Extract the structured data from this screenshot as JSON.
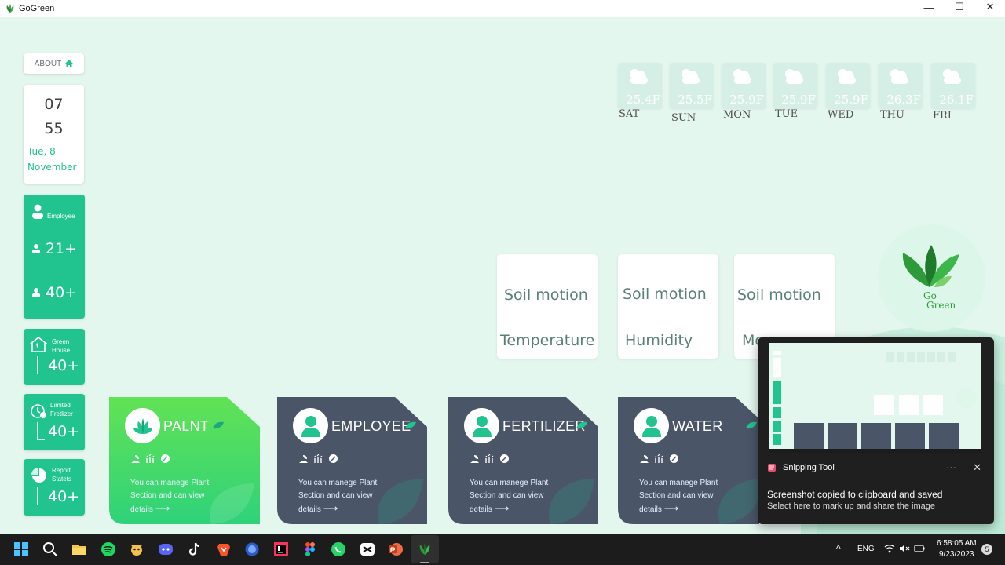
{
  "window": {
    "title": "GoGreen",
    "minimize": "—",
    "maximize": "☐",
    "close": "✕"
  },
  "sidebar": {
    "about_label": "ABOUT",
    "clock": {
      "hour": "07",
      "minute": "55",
      "date_line1": "Tue, 8",
      "date_line2": "November"
    },
    "employee": {
      "label": "Employee",
      "count1": "21+",
      "count2": "40+"
    },
    "greenhouse": {
      "label_line1": "Green",
      "label_line2": "House",
      "count": "40+"
    },
    "fertilizer": {
      "label_line1": "Limited",
      "label_line2": "Fretlizer",
      "count": "40+"
    },
    "report": {
      "label_line1": "Report",
      "label_line2": "Statets",
      "count": "40+"
    }
  },
  "weather": [
    {
      "temp": "25.4F",
      "day": "SAT"
    },
    {
      "temp": "25.5F",
      "day": "SUN"
    },
    {
      "temp": "25.9F",
      "day": "MON"
    },
    {
      "temp": "25.9F",
      "day": "TUE"
    },
    {
      "temp": "25.9F",
      "day": "WED"
    },
    {
      "temp": "26.3F",
      "day": "THU"
    },
    {
      "temp": "26.1F",
      "day": "FRI"
    }
  ],
  "soil_cards": [
    {
      "line1": "Soil motion",
      "line2": "Temperature"
    },
    {
      "line1": "Soil motion",
      "line2": "Humidity"
    },
    {
      "line1": "Soil motion",
      "line2": "Mo"
    }
  ],
  "logo": {
    "text1": "Go",
    "text2": "Green"
  },
  "cards": [
    {
      "name": "PALNT",
      "desc1": "You can manege Plant",
      "desc2": "Section and can view",
      "desc3": "details",
      "arrow": "⟶"
    },
    {
      "name": "EMPLOYEE",
      "desc1": "You can manege Plant",
      "desc2": "Section and can view",
      "desc3": "details",
      "arrow": "⟶"
    },
    {
      "name": "FERTILIZER",
      "desc1": "You can manege Plant",
      "desc2": "Section and can view",
      "desc3": "details",
      "arrow": "⟶"
    },
    {
      "name": "WATER",
      "desc1": "You can manege Plant",
      "desc2": "Section and can view",
      "desc3": "details",
      "arrow": "⟶"
    }
  ],
  "snipping": {
    "app_name": "Snipping Tool",
    "more": "···",
    "close": "✕",
    "message": "Screenshot copied to clipboard and saved",
    "sub": "Select here to mark up and share the image"
  },
  "taskbar": {
    "language": "ENG",
    "time": "6:58:05 AM",
    "date": "9/23/2023",
    "badge": "5"
  },
  "colors": {
    "green": "#21c38f",
    "active_card": "#5fe05a",
    "dark_card": "#4a5568",
    "background": "#e4f7ef"
  }
}
